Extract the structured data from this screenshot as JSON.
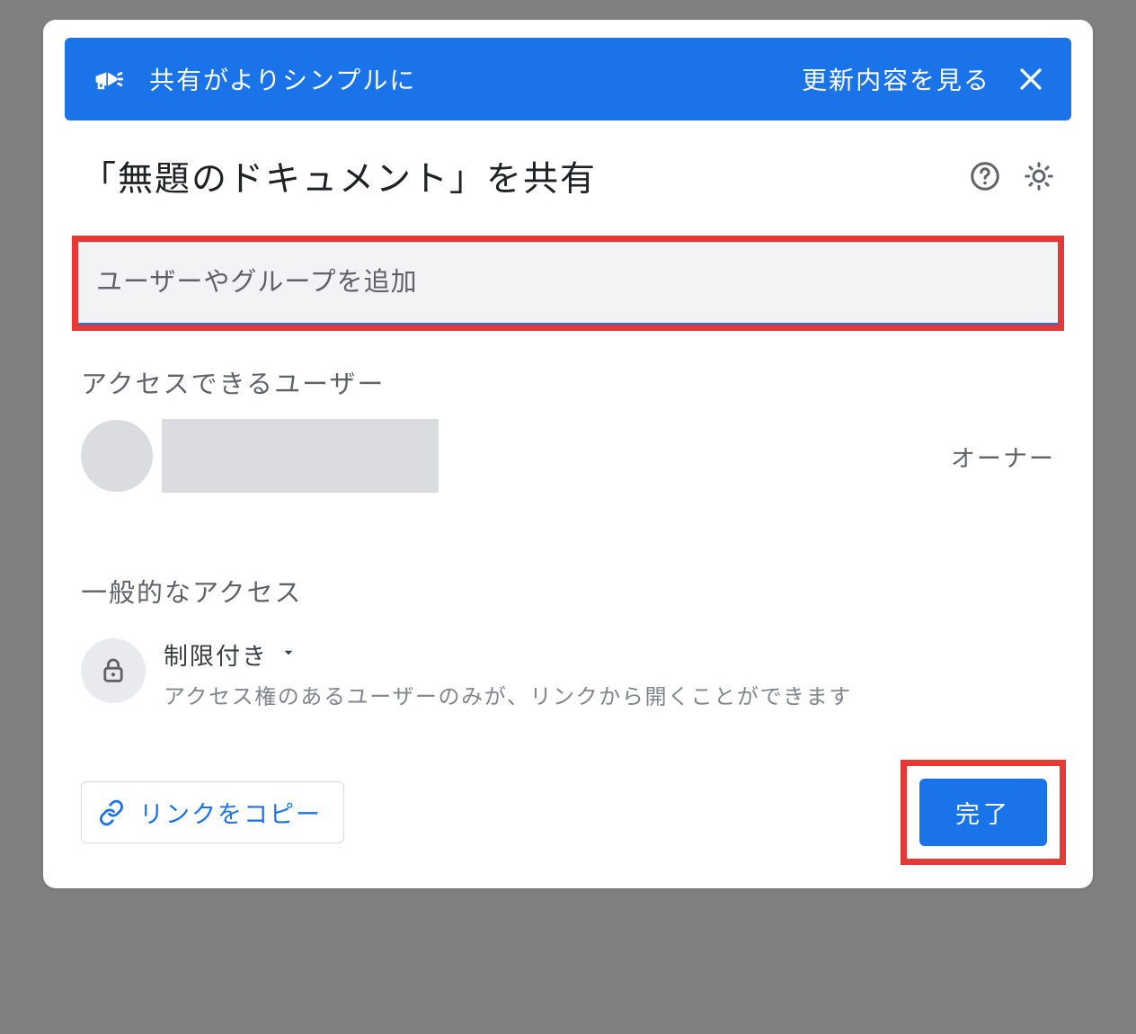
{
  "banner": {
    "message": "共有がよりシンプルに",
    "link_label": "更新内容を見る"
  },
  "dialog": {
    "title": "「無題のドキュメント」を共有",
    "input_placeholder": "ユーザーやグループを追加"
  },
  "sections": {
    "people_label": "アクセスできるユーザー",
    "general_access_label": "一般的なアクセス"
  },
  "people": [
    {
      "role": "オーナー"
    }
  ],
  "general_access": {
    "mode": "制限付き",
    "description": "アクセス権のあるユーザーのみが、リンクから開くことができます"
  },
  "footer": {
    "copy_link_label": "リンクをコピー",
    "done_label": "完了"
  },
  "colors": {
    "primary": "#1a73e8",
    "highlight": "#e53935",
    "text": "#202124",
    "muted": "#5f6368"
  }
}
